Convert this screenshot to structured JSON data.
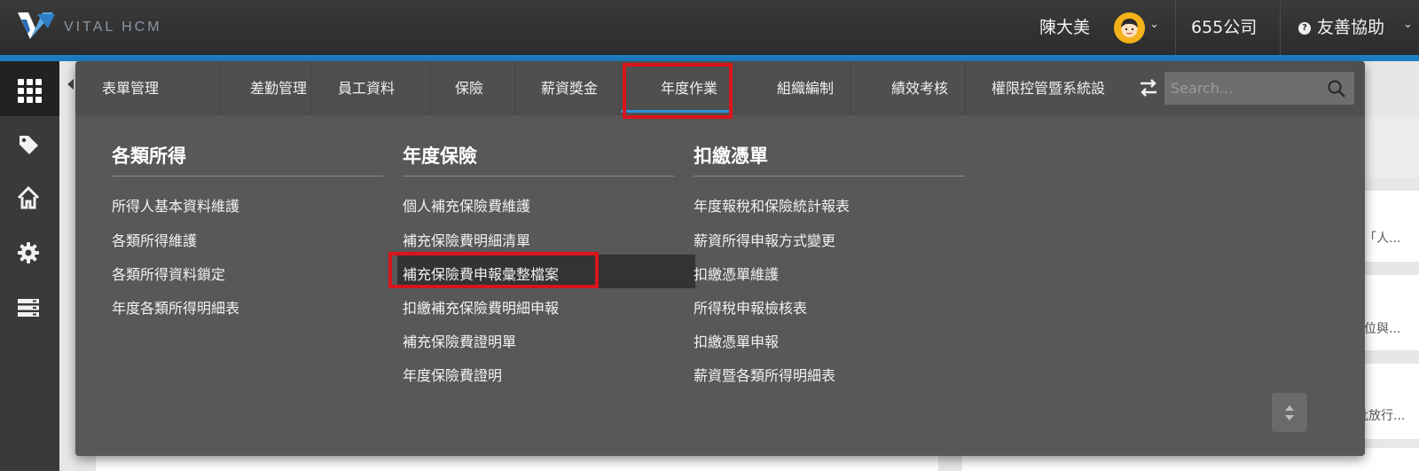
{
  "header": {
    "brand": "VITAL HCM",
    "user_name": "陳大美",
    "company": "655公司",
    "help_label": "友善協助"
  },
  "menu": {
    "tabs": [
      {
        "label": "表單管理"
      },
      {
        "label": "差勤管理"
      },
      {
        "label": "員工資料"
      },
      {
        "label": "保險"
      },
      {
        "label": "薪資獎金"
      },
      {
        "label": "年度作業",
        "active": true
      },
      {
        "label": "組織編制"
      },
      {
        "label": "績效考核"
      },
      {
        "label": "權限控管暨系統設"
      }
    ],
    "search": {
      "placeholder": "Search..."
    },
    "columns": [
      {
        "title": "各類所得",
        "items": [
          "所得人基本資料維護",
          "各類所得維護",
          "各類所得資料鎖定",
          "年度各類所得明細表"
        ]
      },
      {
        "title": "年度保險",
        "items": [
          "個人補充保險費維護",
          "補充保險費明細清單",
          "補充保險費申報彙整檔案",
          "扣繳補充保險費明細申報",
          "補充保險費證明單",
          "年度保險費證明"
        ]
      },
      {
        "title": "扣繳憑單",
        "items": [
          "年度報稅和保險統計報表",
          "薪資所得申報方式變更",
          "扣繳憑單維護",
          "所得稅申報檢核表",
          "扣繳憑單申報",
          "薪資暨各類所得明細表"
        ]
      }
    ]
  },
  "background": {
    "snippets": [
      "「人...",
      "位與...",
      "批放行..."
    ]
  },
  "colors": {
    "accent": "#1c7fc4",
    "highlight_box": "#d8141c",
    "menu_bg": "#585858"
  }
}
